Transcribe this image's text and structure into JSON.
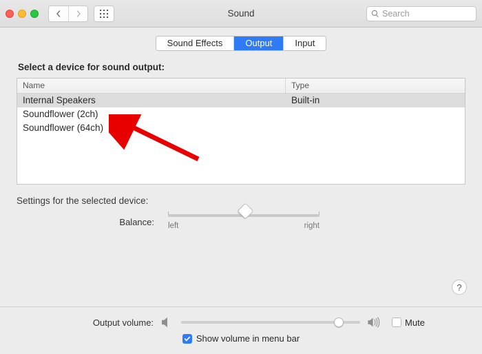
{
  "window": {
    "title": "Sound"
  },
  "toolbar": {
    "search_placeholder": "Search"
  },
  "tabs": {
    "items": [
      {
        "label": "Sound Effects",
        "active": false
      },
      {
        "label": "Output",
        "active": true
      },
      {
        "label": "Input",
        "active": false
      }
    ]
  },
  "output": {
    "select_heading": "Select a device for sound output:",
    "columns": {
      "name": "Name",
      "type": "Type"
    },
    "devices": [
      {
        "name": "Internal Speakers",
        "type": "Built-in",
        "selected": true
      },
      {
        "name": "Soundflower (2ch)",
        "type": "",
        "selected": false
      },
      {
        "name": "Soundflower (64ch)",
        "type": "",
        "selected": false
      }
    ],
    "settings_heading": "Settings for the selected device:",
    "balance": {
      "label": "Balance:",
      "left": "left",
      "right": "right",
      "value": 0.5
    }
  },
  "footer": {
    "volume_label": "Output volume:",
    "volume_value": 0.88,
    "mute_label": "Mute",
    "mute_checked": false,
    "show_in_menubar_label": "Show volume in menu bar",
    "show_in_menubar_checked": true
  },
  "help": {
    "label": "?"
  }
}
